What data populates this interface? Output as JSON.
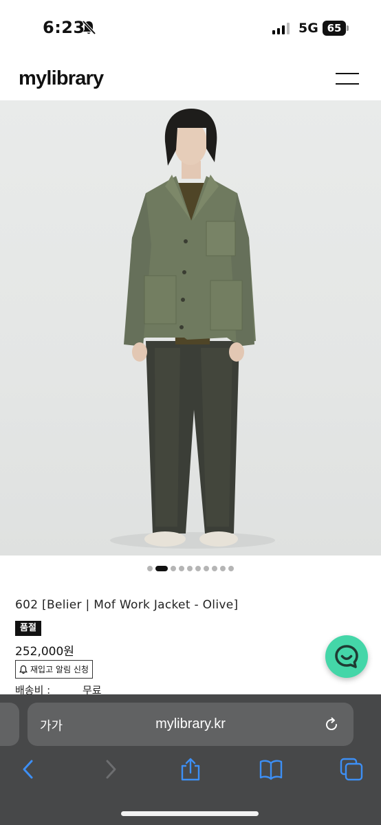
{
  "status_bar": {
    "time": "6:23",
    "network": "5G",
    "battery": "65"
  },
  "header": {
    "logo": "mylibrary",
    "menu_icon": "hamburger-menu-icon"
  },
  "carousel": {
    "total": 10,
    "active_index": 1
  },
  "product": {
    "title": "602 [Belier | Mof Work Jacket - Olive]",
    "badge": "품절",
    "price": "252,000원",
    "restock_label": "재입고 알림 신청",
    "shipping_label": "배송비 :",
    "shipping_value": "무료"
  },
  "browser": {
    "text_size_label": "가가",
    "url": "mylibrary.kr"
  },
  "colors": {
    "chat_button": "#44d6a8",
    "browser_accent": "#3d8ff5",
    "browser_background": "#474849"
  }
}
